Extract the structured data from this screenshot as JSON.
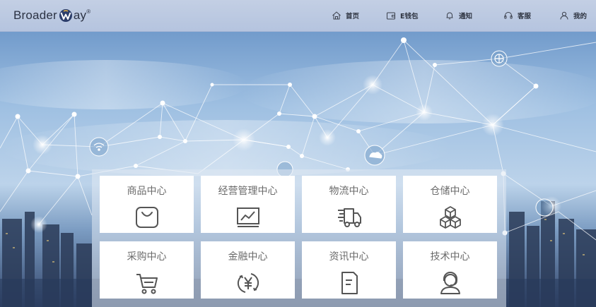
{
  "header": {
    "logo_text_left": "Broader",
    "logo_text_right": "ay",
    "logo_trademark": "®",
    "nav": [
      {
        "label": "首页",
        "icon": "home-icon"
      },
      {
        "label": "E钱包",
        "icon": "wallet-icon"
      },
      {
        "label": "通知",
        "icon": "bell-icon"
      },
      {
        "label": "客服",
        "icon": "headset-icon"
      },
      {
        "label": "我的",
        "icon": "user-icon"
      }
    ]
  },
  "tiles": [
    {
      "label": "商品中心",
      "icon": "shopping-bag-icon"
    },
    {
      "label": "经营管理中心",
      "icon": "line-chart-icon"
    },
    {
      "label": "物流中心",
      "icon": "delivery-truck-icon"
    },
    {
      "label": "仓储中心",
      "icon": "boxes-icon"
    },
    {
      "label": "采购中心",
      "icon": "shopping-cart-icon"
    },
    {
      "label": "金融中心",
      "icon": "yuan-coin-icon"
    },
    {
      "label": "资讯中心",
      "icon": "document-icon"
    },
    {
      "label": "技术中心",
      "icon": "support-agent-icon"
    }
  ],
  "colors": {
    "header_bg": "#b9c7e0",
    "icon_stroke": "#555555",
    "tile_text": "#6b6b6b",
    "sky_top": "#3f6fa8",
    "sky_mid": "#a9c7e4"
  }
}
